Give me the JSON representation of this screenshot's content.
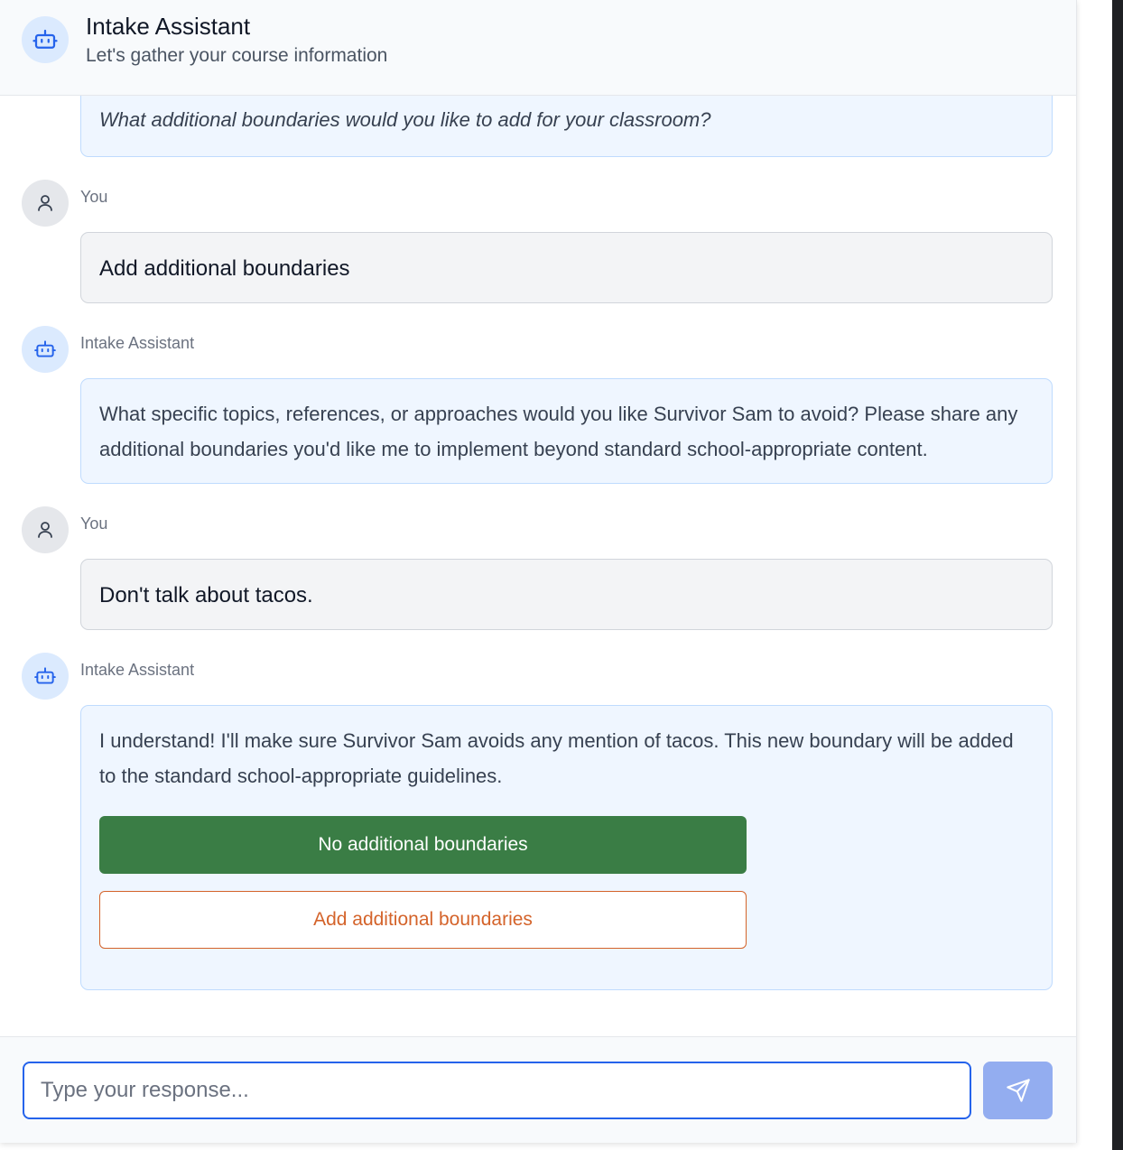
{
  "header": {
    "title": "Intake Assistant",
    "subtitle": "Let's gather your course information"
  },
  "messages": [
    {
      "role": "assistant",
      "text": "What additional boundaries would you like to add for your classroom?"
    },
    {
      "role": "user",
      "sender": "You",
      "text": "Add additional boundaries"
    },
    {
      "role": "assistant",
      "sender": "Intake Assistant",
      "text": "What specific topics, references, or approaches would you like Survivor Sam to avoid? Please share any additional boundaries you'd like me to implement beyond standard school-appropriate content."
    },
    {
      "role": "user",
      "sender": "You",
      "text": "Don't talk about tacos."
    },
    {
      "role": "assistant",
      "sender": "Intake Assistant",
      "text": "I understand! I'll make sure Survivor Sam avoids any mention of tacos. This new boundary will be added to the standard school-appropriate guidelines."
    }
  ],
  "options": {
    "primary_label": "No additional boundaries",
    "secondary_label": "Add additional boundaries"
  },
  "input": {
    "placeholder": "Type your response...",
    "value": ""
  },
  "icons": {
    "assistant": "bot-icon",
    "user": "user-icon",
    "send": "send-icon"
  },
  "colors": {
    "primary_button": "#3a7d45",
    "secondary_button_text": "#d4632a",
    "input_focus": "#2563eb",
    "send_button": "#93adf0",
    "assistant_bubble": "#eff6ff",
    "user_bubble": "#f3f4f6"
  }
}
